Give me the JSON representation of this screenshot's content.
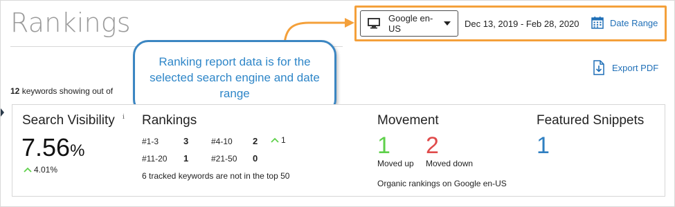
{
  "header": {
    "title": "Rankings",
    "engine_select": {
      "label": "Google en-US",
      "icon": "monitor-icon"
    },
    "date_range_text": "Dec 13, 2019 - Feb 28, 2020",
    "date_range_button": {
      "label": "Date Range",
      "icon": "calendar-icon"
    },
    "highlight_color": "#f4a03a"
  },
  "callout": {
    "text": "Ranking report data is for the selected search engine and date range",
    "color": "#2e86c8"
  },
  "export": {
    "label": "Export PDF",
    "icon": "pdf-download-icon"
  },
  "keyword_summary": {
    "count": "12",
    "text": "keywords showing out of"
  },
  "search_visibility": {
    "title": "Search Visibility",
    "info": "i",
    "value": "7.56",
    "unit": "%",
    "change": "4.01%"
  },
  "rankings": {
    "title": "Rankings",
    "buckets": [
      {
        "label": "#1-3",
        "count": "3"
      },
      {
        "label": "#4-10",
        "count": "2"
      },
      {
        "label": "#11-20",
        "count": "1"
      },
      {
        "label": "#21-50",
        "count": "0"
      }
    ],
    "delta": "1",
    "note": "6 tracked keywords are not in the top 50"
  },
  "movement": {
    "title": "Movement",
    "up_value": "1",
    "up_label": "Moved up",
    "down_value": "2",
    "down_label": "Moved down",
    "note": "Organic rankings on Google en-US",
    "up_color": "#5ed04a",
    "down_color": "#e04b4b"
  },
  "featured_snippets": {
    "title": "Featured Snippets",
    "value": "1",
    "color": "#2f7fc1"
  }
}
